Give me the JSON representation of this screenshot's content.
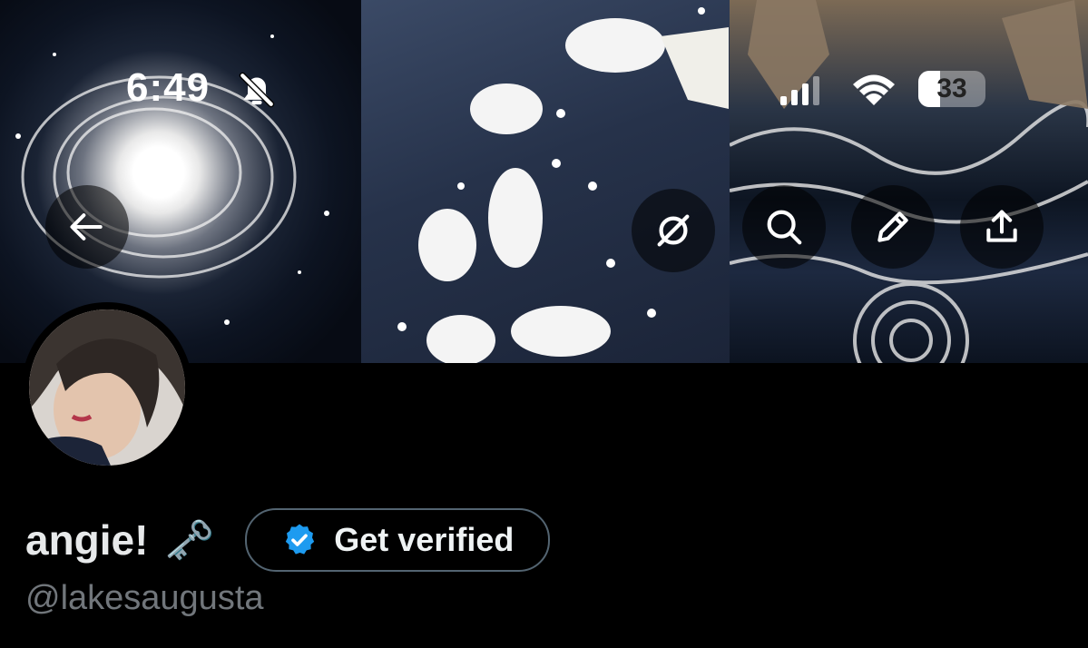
{
  "status_bar": {
    "time": "6:49",
    "battery": "33",
    "icons": [
      "bell-slash-icon",
      "cellular-signal-icon",
      "wifi-icon",
      "battery-icon"
    ]
  },
  "header": {
    "actions": [
      "back-arrow-icon",
      "grok-icon",
      "search-icon",
      "edit-pencil-icon",
      "share-icon"
    ]
  },
  "profile": {
    "name": "angie!",
    "emoji": "🗝️",
    "handle": "@lakesaugusta",
    "verify_button_label": "Get verified"
  },
  "colors": {
    "background": "#000000",
    "name_text": "#e7e9ea",
    "handle_text": "#71767b",
    "verified_badge": "#1d9bf0",
    "button_border": "#536471"
  }
}
